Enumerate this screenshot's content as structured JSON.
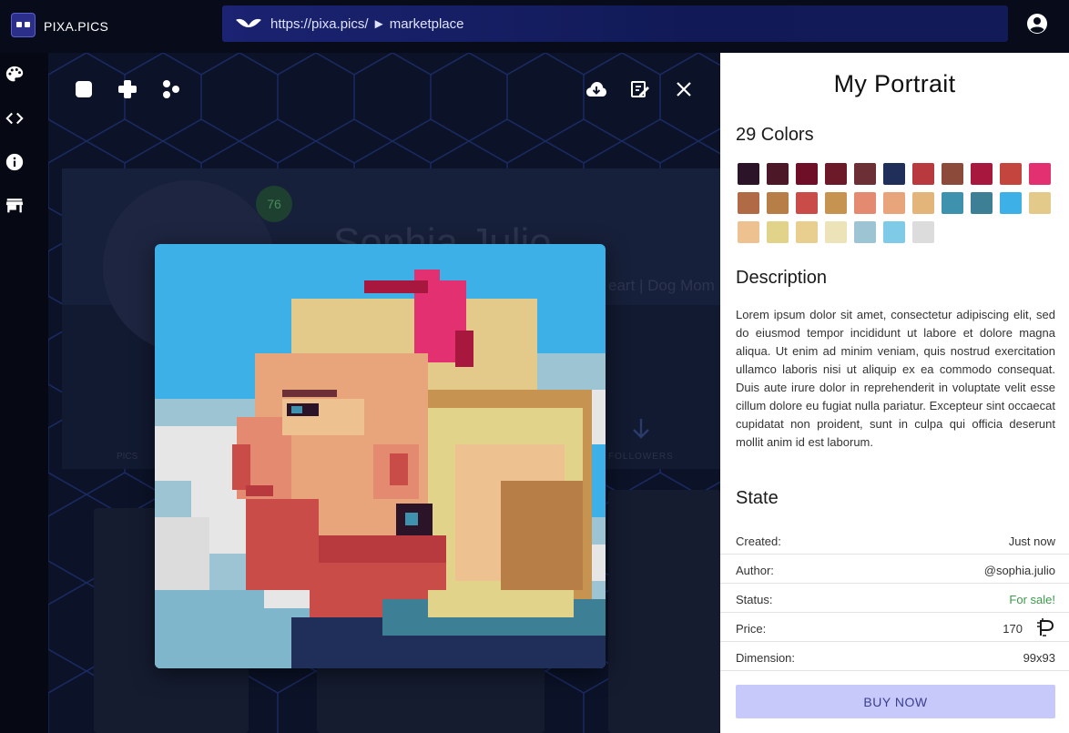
{
  "app": {
    "brand": "PIXA.PICS"
  },
  "address_bar": {
    "url_base": "https://pixa.pics/",
    "separator": "►",
    "path": "marketplace"
  },
  "background_profile": {
    "name": "Sophia Julio",
    "tagline": "eart | Dog Mom",
    "badge": "76",
    "tab_left": "PICS",
    "tab_right": "FOLLOWERS"
  },
  "panel": {
    "title": "My Portrait",
    "colors_title": "29 Colors",
    "palette": [
      "#2b1428",
      "#4c1726",
      "#6e0f27",
      "#6c1a2a",
      "#6b2f35",
      "#1f2f5a",
      "#b83a3e",
      "#8c4a3a",
      "#a8183e",
      "#c4443e",
      "#e23070",
      "#b06a45",
      "#b87e48",
      "#c94c48",
      "#c79350",
      "#e38a70",
      "#e8a57c",
      "#e3b57a",
      "#3e92ae",
      "#3d8095",
      "#3db0e8",
      "#e3c98a",
      "#eec190",
      "#e1d48a",
      "#e8cf8f",
      "#ece3b8",
      "#9cc4d3",
      "#7fcae6",
      "#dcdcdc"
    ],
    "description_title": "Description",
    "description": "Lorem ipsum dolor sit amet, consectetur adipiscing elit, sed do eiusmod tempor incididunt ut labore et dolore magna aliqua. Ut enim ad minim veniam, quis nostrud exercitation ullamco laboris nisi ut aliquip ex ea commodo consequat. Duis aute irure dolor in reprehenderit in voluptate velit esse cillum dolore eu fugiat nulla pariatur. Excepteur sint occaecat cupidatat non proident, sunt in culpa qui officia deserunt mollit anim id est laborum.",
    "state_title": "State",
    "state": {
      "created_label": "Created:",
      "created_value": "Just now",
      "author_label": "Author:",
      "author_value": "@sophia.julio",
      "status_label": "Status:",
      "status_value": "For sale!",
      "price_label": "Price:",
      "price_value": "170",
      "dimension_label": "Dimension:",
      "dimension_value": "99x93"
    },
    "buy_label": "BUY NOW"
  },
  "icons": {
    "topbar": [
      "pixa-logo-icon",
      "wings-icon",
      "account-circle-icon"
    ],
    "rail": [
      "palette-icon",
      "code-icon",
      "info-icon",
      "store-icon"
    ],
    "viewer_toolbar": [
      "square-icon",
      "plus-icon",
      "dots-icon",
      "cloud-download-icon",
      "edit-icon",
      "close-icon"
    ],
    "price": "coin-icon"
  },
  "colors": {
    "status_green": "#3d9a4b",
    "buy_button": "#c7c9fb",
    "url_bar": "#1b2372"
  }
}
